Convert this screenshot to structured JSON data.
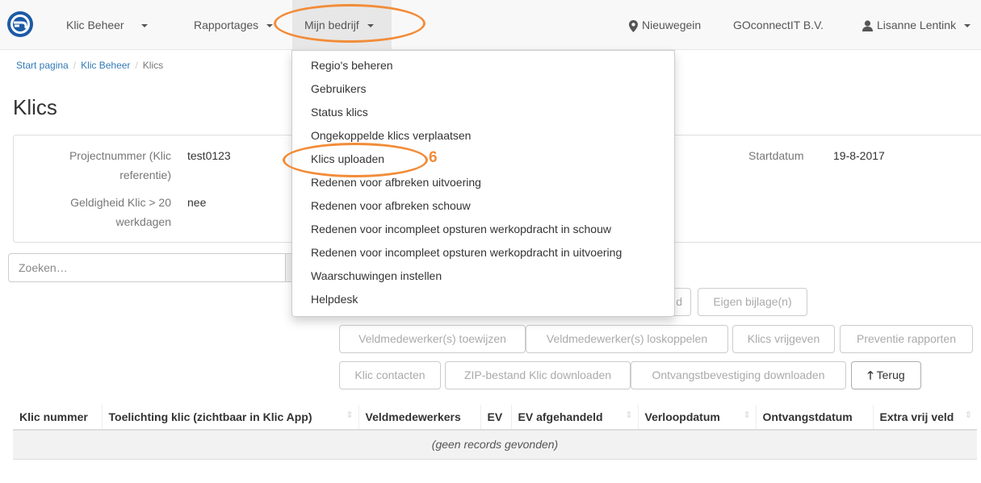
{
  "nav": {
    "menu_klic_beheer": "Klic Beheer",
    "menu_rapportages": "Rapportages",
    "menu_mijn_bedrijf": "Mijn bedrijf",
    "location": "Nieuwegein",
    "company": "GOconnectIT B.V.",
    "user": "Lisanne Lentink",
    "icons": {
      "logo": "goconnectit-logo",
      "location": "map-marker-icon",
      "user": "user-icon",
      "caret": "caret-down-icon"
    }
  },
  "breadcrumb": [
    "Start pagina",
    "Klic Beheer",
    "Klics"
  ],
  "page_title": "Klics",
  "details": {
    "project_label": "Projectnummer (Klic referentie)",
    "project_value": "test0123",
    "validity_label": "Geldigheid Klic > 20 werkdagen",
    "validity_value": "nee",
    "start_label": "Startdatum",
    "start_value": "19-8-2017"
  },
  "search": {
    "placeholder": "Zoeken…"
  },
  "buttons": {
    "partial_end": "d",
    "eigen_bijlage": "Eigen bijlage(n)",
    "assign": "Veldmedewerker(s) toewijzen",
    "unlink": "Veldmedewerker(s) loskoppelen",
    "release": "Klics vrijgeven",
    "prevention": "Preventie rapporten",
    "contacts": "Klic contacten",
    "zip": "ZIP-bestand Klic downloaden",
    "receipt": "Ontvangstbevestiging downloaden",
    "back": "Terug"
  },
  "table": {
    "headers": {
      "klic_nummer": "Klic nummer",
      "toelichting": "Toelichting klic (zichtbaar in Klic App)",
      "veldmedewerkers": "Veldmedewerkers",
      "ev": "EV",
      "ev_afgehandeld": "EV afgehandeld",
      "verloopdatum": "Verloopdatum",
      "ontvangstdatum": "Ontvangstdatum",
      "extra_vrij_veld": "Extra vrij veld"
    },
    "empty_text": "(geen records gevonden)"
  },
  "dropdown": {
    "items": [
      "Regio's beheren",
      "Gebruikers",
      "Status klics",
      "Ongekoppelde klics verplaatsen",
      "Klics uploaden",
      "Redenen voor afbreken uitvoering",
      "Redenen voor afbreken schouw",
      "Redenen voor incompleet opsturen werkopdracht in schouw",
      "Redenen voor incompleet opsturen werkopdracht in uitvoering",
      "Waarschuwingen instellen",
      "Helpdesk"
    ]
  },
  "annotation": {
    "step_number": "6",
    "color": "#f28c38"
  },
  "colors": {
    "link": "#337ab7",
    "navbar_bg": "#f8f8f8",
    "logo_blue": "#1c5aa6",
    "annotation": "#f28c38"
  }
}
